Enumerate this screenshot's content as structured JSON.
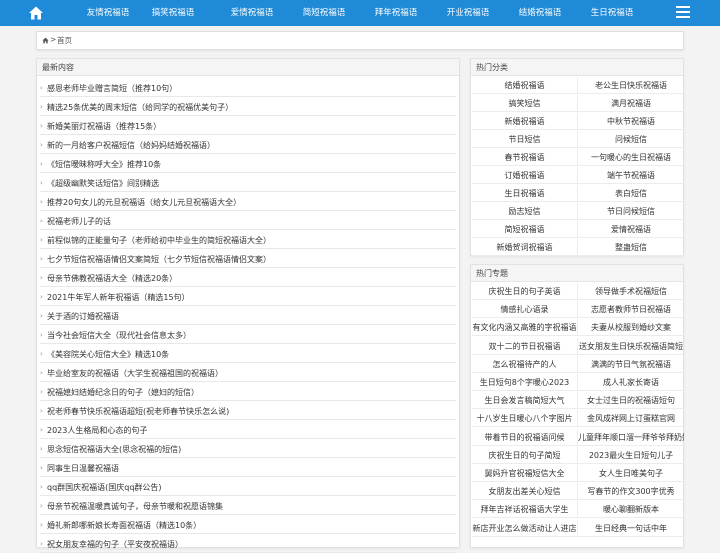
{
  "nav": {
    "home_icon": "home-icon",
    "items": [
      "友情祝福语",
      "搞笑祝福语",
      "爱情祝福语",
      "简短祝福语",
      "拜年祝福语",
      "开业祝福语",
      "结婚祝福语",
      "生日祝福语"
    ],
    "menu_icon": "hamburger-menu-icon",
    "color": "#1f8ad8"
  },
  "breadcrumb": {
    "separator": ">",
    "current": "首页"
  },
  "latest": {
    "title": "最新内容",
    "items": [
      "感恩老师毕业赠言简短（推荐10句）",
      "精选25条优美的周末短信（给同学的祝福优美句子）",
      "新婚美丽灯祝福语（推荐15条）",
      "新的一月给客户祝福短信（给妈妈结婚祝福语）",
      "《短信暧昧称呼大全》推荐10条",
      "《超级幽默笑话短信》间别精选",
      "推荐20句女儿的元旦祝福语（给女儿元旦祝福语大全）",
      "祝福老师儿子的话",
      "前程似锦的正能量句子（老师给初中毕业生的简短祝福语大全）",
      "七夕节短信祝福语情侣文案简短（七夕节短信祝福语情侣文案）",
      "母亲节佛教祝福语大全（精选20条）",
      "2021牛年军人新年祝福语（精选15句）",
      "关于酒的订婚祝福语",
      "当今社会短信大全（现代社会信息太多）",
      "《美容院关心短信大全》精选10条",
      "毕业给室友的祝福语（大学生祝福祖国的祝福语）",
      "祝福媳妇结婚纪念日的句子（媳妇的短信）",
      "祝老师春节快乐祝福语超短(祝老师春节快乐怎么说)",
      "2023人生格局和心态的句子",
      "思念短信祝福语大全(思念祝福的短信)",
      "同事生日温馨祝福语",
      "qq群国庆祝福语(国庆qq群公告)",
      "母亲节祝福温暖真诚句子，母亲节暖和祝愿语锦集",
      "婚礼新郎哪新娘长寿面祝福语（精选10条）",
      "祝女朋友幸福的句子（平安夜祝福语）"
    ]
  },
  "hot_categories": {
    "title": "热门分类",
    "items": [
      "结婚祝福语",
      "老公生日快乐祝福语",
      "搞笑短信",
      "满月祝福语",
      "新婚祝福语",
      "中秋节祝福语",
      "节日短信",
      "问候短信",
      "春节祝福语",
      "一句暖心的生日祝福语",
      "订婚祝福语",
      "端午节祝福语",
      "生日祝福语",
      "表白短信",
      "励志短信",
      "节日问候短信",
      "简短祝福语",
      "爱情祝福语",
      "新婚贺词祝福语",
      "整蛊短信"
    ]
  },
  "hot_topics": {
    "title": "热门专题",
    "items": [
      "庆祝生日的句子英语",
      "领导做手术祝福短信",
      "情感扎心语录",
      "志愿者教师节日祝福语",
      "有文化内涵又高雅的字祝福语",
      "夫妻从校服到婚纱文案",
      "双十二的节日祝福语",
      "送女朋友生日快乐祝福语简短",
      "怎么祝福待产的人",
      "满满的节日气氛祝福语",
      "生日短句8个字暖心2023",
      "成人礼家长寄语",
      "生日会发言稿简短大气",
      "女士过生日的祝福语短句",
      "十八岁生日暖心八个字图片",
      "金风成祥网上订蛋糕官网",
      "带着节日的祝福语问候",
      "儿童拜年顺口溜一拜爷爷拜奶奶",
      "庆祝生日的句子简短",
      "2023最火生日短句儿子",
      "舅妈升官祝福短信大全",
      "女人生日唯美句子",
      "女朋友出差关心短信",
      "写春节的作文300字优秀",
      "拜年吉祥话祝福语大学生",
      "暖心聊翻新版本",
      "新店开业怎么做活动让人进店",
      "生日经典一句话中年"
    ]
  }
}
